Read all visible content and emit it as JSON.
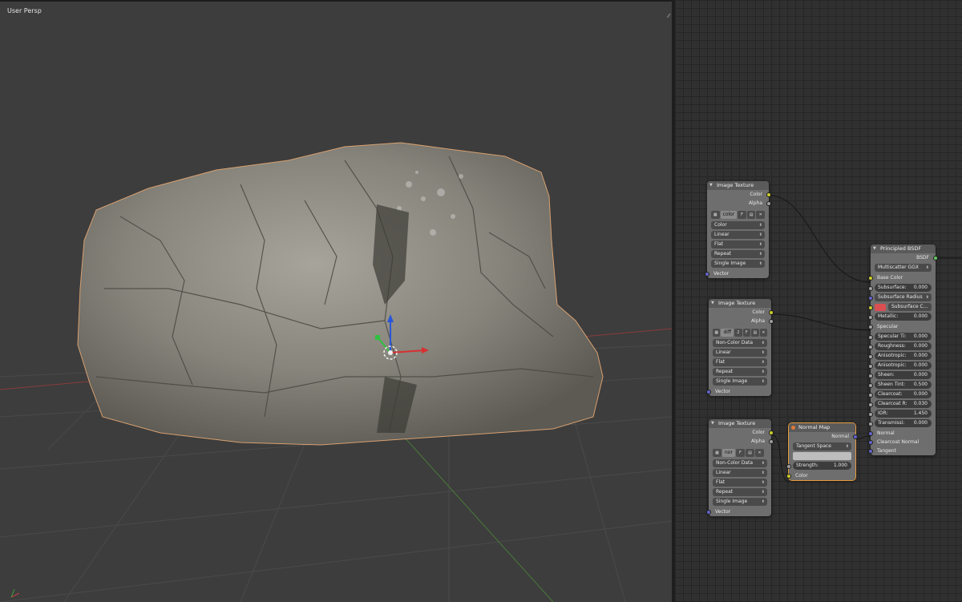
{
  "viewport": {
    "label": "User Persp"
  },
  "nodes": {
    "tex1": {
      "title": "Image Texture",
      "out_color": "Color",
      "out_alpha": "Alpha",
      "image_name": "color",
      "fake_user": "F",
      "colorspace": "Color",
      "interpolation": "Linear",
      "projection": "Flat",
      "extension": "Repeat",
      "source": "Single Image",
      "in_vector": "Vector"
    },
    "tex2": {
      "title": "Image Texture",
      "out_color": "Color",
      "out_alpha": "Alpha",
      "image_name": "diff",
      "image_users": "2",
      "fake_user": "F",
      "colorspace": "Non-Color Data",
      "interpolation": "Linear",
      "projection": "Flat",
      "extension": "Repeat",
      "source": "Single Image",
      "in_vector": "Vector"
    },
    "tex3": {
      "title": "Image Texture",
      "out_color": "Color",
      "out_alpha": "Alpha",
      "image_name": "nor",
      "fake_user": "F",
      "colorspace": "Non-Color Data",
      "interpolation": "Linear",
      "projection": "Flat",
      "extension": "Repeat",
      "source": "Single Image",
      "in_vector": "Vector"
    },
    "normal_map": {
      "title": "Normal Map",
      "out_normal": "Normal",
      "space": "Tangent Space",
      "strength_label": "Strength:",
      "strength_value": "1.000",
      "in_color": "Color"
    },
    "bsdf": {
      "title": "Principled BSDF",
      "out_bsdf": "BSDF",
      "distribution": "Multiscatter GGX",
      "base_color": "Base Color",
      "subsurface_label": "Subsurface:",
      "subsurface_value": "0.000",
      "subsurface_method": "Subsurface Radius",
      "subsurface_color": "Subsurface C...",
      "metallic_label": "Metallic:",
      "metallic_value": "0.000",
      "specular": "Specular",
      "specular_tint_label": "Specular Ti:",
      "specular_tint_value": "0.000",
      "roughness_label": "Roughness:",
      "roughness_value": "0.000",
      "anisotropic_label": "Anisotropic:",
      "anisotropic_value": "0.000",
      "anisotropic_rot_label": "Anisotropic:",
      "anisotropic_rot_value": "0.000",
      "sheen_label": "Sheen:",
      "sheen_value": "0.000",
      "sheen_tint_label": "Sheen Tint:",
      "sheen_tint_value": "0.500",
      "clearcoat_label": "Clearcoat:",
      "clearcoat_value": "0.000",
      "clearcoat_r_label": "Clearcoat R:",
      "clearcoat_r_value": "0.030",
      "ior_label": "IOR:",
      "ior_value": "1.450",
      "transmission_label": "Transmissi:",
      "transmission_value": "0.000",
      "in_normal": "Normal",
      "in_clearcoat_normal": "Clearcoat Normal",
      "in_tangent": "Tangent",
      "subsurface_swatch_color": "#d94f52"
    }
  }
}
